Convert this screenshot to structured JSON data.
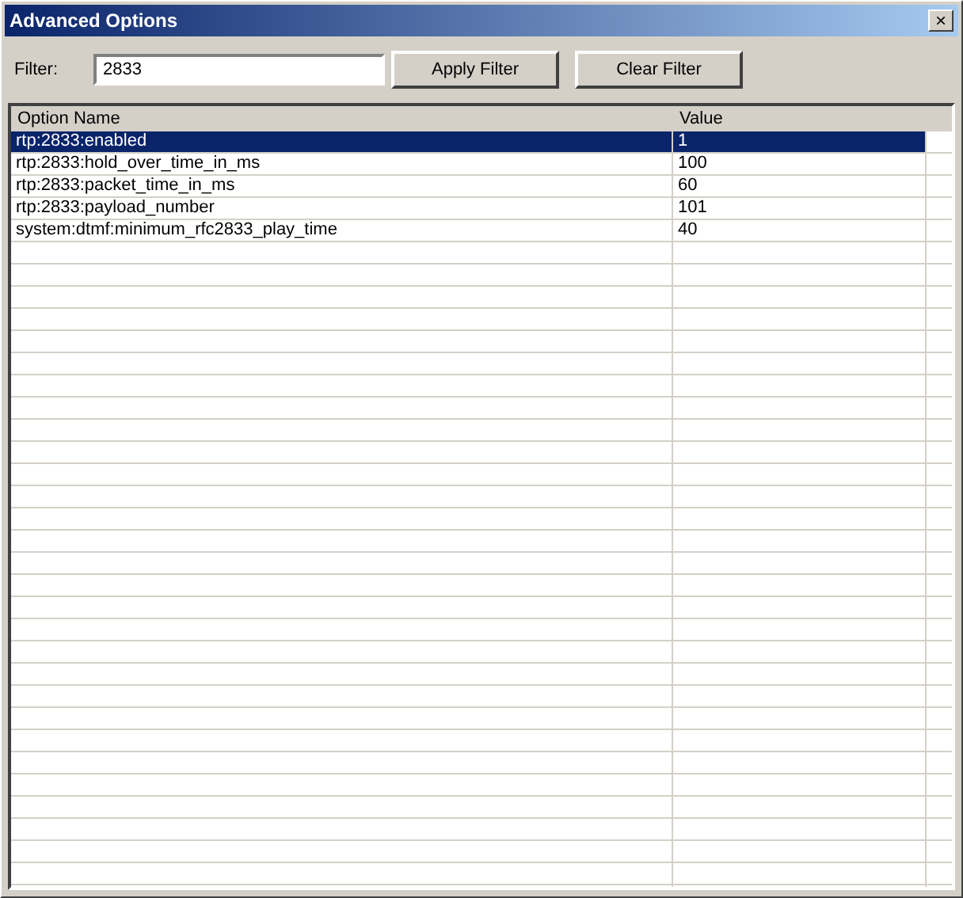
{
  "window": {
    "title": "Advanced Options",
    "close": "×"
  },
  "filter": {
    "label": "Filter:",
    "value": "2833"
  },
  "buttons": [
    "Apply Filter",
    "Clear Filter"
  ],
  "table": {
    "columns": [
      "Option Name",
      "Value"
    ],
    "rows": [
      {
        "name": "rtp:2833:enabled",
        "value": "1",
        "selected": true
      },
      {
        "name": "rtp:2833:hold_over_time_in_ms",
        "value": "100",
        "selected": false
      },
      {
        "name": "rtp:2833:packet_time_in_ms",
        "value": "60",
        "selected": false
      },
      {
        "name": "rtp:2833:payload_number",
        "value": "101",
        "selected": false
      },
      {
        "name": "system:dtmf:minimum_rfc2833_play_time",
        "value": "40",
        "selected": false
      }
    ]
  }
}
